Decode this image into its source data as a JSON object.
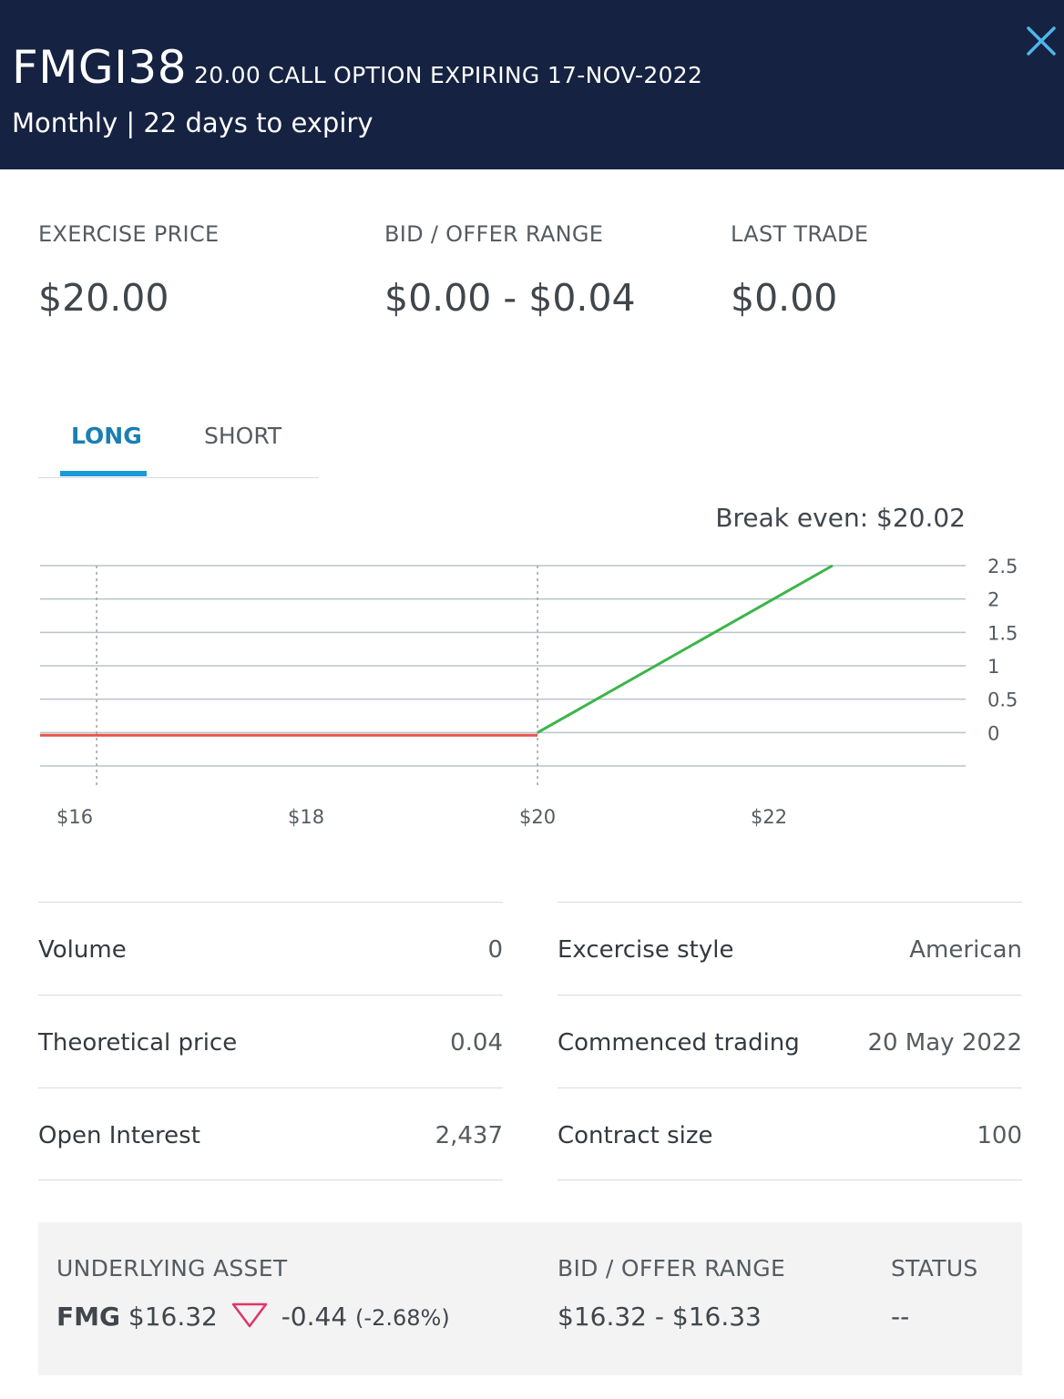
{
  "header": {
    "symbol": "FMGI38",
    "description": "20.00 CALL OPTION EXPIRING 17-NOV-2022",
    "subtitle": "Monthly | 22 days to expiry"
  },
  "stats": [
    {
      "label": "EXERCISE PRICE",
      "value": "$20.00"
    },
    {
      "label": "BID / OFFER RANGE",
      "value": "$0.00 - $0.04"
    },
    {
      "label": "LAST TRADE",
      "value": "$0.00"
    }
  ],
  "tabs": {
    "long": "LONG",
    "short": "SHORT",
    "selected": "LONG"
  },
  "chart_data": {
    "type": "line",
    "title": "Break even: $20.02",
    "x_ticks": [
      "$16",
      "$18",
      "$20",
      "$22"
    ],
    "y_ticks": [
      "2.5",
      "2",
      "1.5",
      "1",
      "0.5",
      "0"
    ],
    "xlim": [
      15.7,
      23.7
    ],
    "ylim": [
      -0.5,
      2.5
    ],
    "grid": true,
    "series": [
      {
        "segment": "loss",
        "color": "#e8534a",
        "x": [
          15.7,
          20.0
        ],
        "y": [
          -0.04,
          -0.04
        ]
      },
      {
        "segment": "profit",
        "color": "#3bb54a",
        "x": [
          20.0,
          22.55
        ],
        "y": [
          0,
          2.5
        ]
      }
    ]
  },
  "details_left": [
    {
      "key": "Volume",
      "value": "0"
    },
    {
      "key": "Theoretical price",
      "value": "0.04"
    },
    {
      "key": "Open Interest",
      "value": "2,437"
    }
  ],
  "details_right": [
    {
      "key": "Excercise style",
      "value": "American"
    },
    {
      "key": "Commenced trading",
      "value": "20 May 2022"
    },
    {
      "key": "Contract size",
      "value": "100"
    }
  ],
  "underlying": {
    "asset_label": "UNDERLYING ASSET",
    "code": "FMG",
    "price": "$16.32",
    "change": "-0.44",
    "change_pct": "(-2.68%)",
    "range_label": "BID / OFFER RANGE",
    "range": "$16.32 - $16.33",
    "status_label": "STATUS",
    "status": "--",
    "down_color": "#e0356b"
  }
}
